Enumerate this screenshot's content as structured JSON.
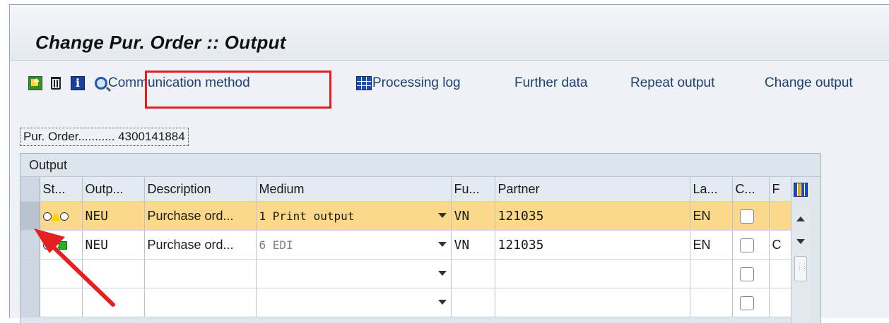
{
  "window": {
    "title": "Change Pur. Order :: Output"
  },
  "toolbar": {
    "items": [
      {
        "icon": "create-icon",
        "label": ""
      },
      {
        "icon": "trash-icon",
        "label": ""
      },
      {
        "icon": "info-icon",
        "label": "i"
      },
      {
        "icon": "communication-method-icon",
        "label": "Communication method"
      },
      {
        "icon": "processing-log-icon",
        "label": "Processing log"
      },
      {
        "icon": "",
        "label": "Further data"
      },
      {
        "icon": "",
        "label": "Repeat output"
      },
      {
        "icon": "",
        "label": "Change output"
      }
    ]
  },
  "header": {
    "pur_order_label": "Pur. Order........... 4300141884"
  },
  "panel": {
    "title": "Output"
  },
  "table": {
    "columns": [
      "St...",
      "Outp...",
      "Description",
      "Medium",
      "Fu...",
      "Partner",
      "La...",
      "C...",
      "F"
    ],
    "rows": [
      {
        "status": "yellow",
        "output": "NEU",
        "description": "Purchase ord...",
        "medium": "1 Print output",
        "function": "VN",
        "partner": "121035",
        "language": "EN",
        "c_checked": false,
        "f": "",
        "selected": true
      },
      {
        "status": "green",
        "output": "NEU",
        "description": "Purchase ord...",
        "medium": "6 EDI",
        "function": "VN",
        "partner": "121035",
        "language": "EN",
        "c_checked": false,
        "f": "C",
        "selected": false
      },
      {
        "status": "",
        "output": "",
        "description": "",
        "medium": "",
        "function": "",
        "partner": "",
        "language": "",
        "c_checked": false,
        "f": "",
        "selected": false
      },
      {
        "status": "",
        "output": "",
        "description": "",
        "medium": "",
        "function": "",
        "partner": "",
        "language": "",
        "c_checked": false,
        "f": "",
        "selected": false
      }
    ]
  },
  "colors": {
    "selected_row": "#fcd98a",
    "annotation": "#e02020",
    "link_text": "#1f3f74"
  }
}
